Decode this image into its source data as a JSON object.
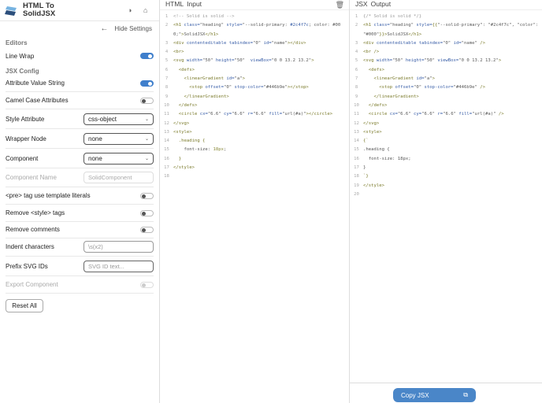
{
  "app": {
    "title_line1": "HTML To",
    "title_line2": "SolidJSX",
    "theme_icon": "contrast-icon",
    "github_icon": "github-icon",
    "accent": "#3f7fcc"
  },
  "settings": {
    "hide_label": "Hide Settings",
    "editors_heading": "Editors",
    "line_wrap": {
      "label": "Line Wrap",
      "on": true
    },
    "jsx_heading": "JSX Config",
    "attribute_value_string": {
      "label": "Attribute Value String",
      "on": true
    },
    "camel_case": {
      "label": "Camel Case Attributes",
      "on": false
    },
    "style_attribute": {
      "label": "Style Attribute",
      "value": "css-object"
    },
    "wrapper_node": {
      "label": "Wrapper Node",
      "value": "none"
    },
    "component": {
      "label": "Component",
      "value": "none"
    },
    "component_name": {
      "label": "Component Name",
      "placeholder": "SolidComponent"
    },
    "pre_tag": {
      "label": "<pre> tag use template literals",
      "on": false
    },
    "remove_style": {
      "label": "Remove <style> tags",
      "on": false
    },
    "remove_comments": {
      "label": "Remove comments",
      "on": false
    },
    "indent": {
      "label": "Indent characters",
      "placeholder": "\\s(x2)"
    },
    "prefix_svg": {
      "label": "Prefix SVG IDs",
      "placeholder": "SVG ID text..."
    },
    "export_component": {
      "label": "Export Component",
      "on": false
    },
    "reset_label": "Reset All"
  },
  "input": {
    "title_a": "HTML",
    "title_b": "Input",
    "lines": [
      [
        [
          "comment",
          "<!-- Solid is solid -->"
        ]
      ],
      [
        [
          "tag",
          "<h1 "
        ],
        [
          "attr",
          "class="
        ],
        [
          "str",
          "\"heading\" "
        ],
        [
          "attr",
          "style="
        ],
        [
          "str",
          "\"--solid-primary: "
        ],
        [
          "attr",
          "#2c4f7c"
        ],
        [
          "str",
          "; color: #000;\""
        ],
        [
          "tag",
          ">"
        ],
        [
          "plain",
          "SolidJSX"
        ],
        [
          "tag",
          "</h1>"
        ]
      ],
      [
        [
          "tag",
          "<div "
        ],
        [
          "attr",
          "contenteditable tabindex="
        ],
        [
          "str",
          "\"0\" "
        ],
        [
          "attr",
          "id="
        ],
        [
          "str",
          "\"name\""
        ],
        [
          "tag",
          "></div>"
        ]
      ],
      [
        [
          "tag",
          "<br>"
        ]
      ],
      [
        [
          "tag",
          "<svg "
        ],
        [
          "attr",
          "width="
        ],
        [
          "str",
          "\"50\" "
        ],
        [
          "attr",
          "height="
        ],
        [
          "str",
          "\"50\"  "
        ],
        [
          "attr",
          "viewBox="
        ],
        [
          "str",
          "\"0 0 13.2 13.2\""
        ],
        [
          "tag",
          ">"
        ]
      ],
      [
        [
          "tag",
          "  <defs>"
        ]
      ],
      [
        [
          "tag",
          "    <linearGradient "
        ],
        [
          "attr",
          "id="
        ],
        [
          "str",
          "\"a\""
        ],
        [
          "tag",
          ">"
        ]
      ],
      [
        [
          "tag",
          "      <stop "
        ],
        [
          "attr",
          "offset="
        ],
        [
          "str",
          "\"0\" "
        ],
        [
          "attr",
          "stop-color="
        ],
        [
          "str",
          "\"#446b9e\""
        ],
        [
          "tag",
          "></stop>"
        ]
      ],
      [
        [
          "tag",
          "    </linearGradient>"
        ]
      ],
      [
        [
          "tag",
          "  </defs>"
        ]
      ],
      [
        [
          "tag",
          "  <circle "
        ],
        [
          "attr",
          "cx="
        ],
        [
          "str",
          "\"6.6\" "
        ],
        [
          "attr",
          "cy="
        ],
        [
          "str",
          "\"6.6\" "
        ],
        [
          "attr",
          "r="
        ],
        [
          "str",
          "\"6.6\" "
        ],
        [
          "attr",
          "fill="
        ],
        [
          "str",
          "\"url(#a)\""
        ],
        [
          "tag",
          "></circle>"
        ]
      ],
      [
        [
          "tag",
          "</svg>"
        ]
      ],
      [
        [
          "tag",
          "<style>"
        ]
      ],
      [
        [
          "tag",
          "  .heading {"
        ]
      ],
      [
        [
          "plain",
          "    font-size: "
        ],
        [
          "num",
          "18px"
        ],
        [
          "plain",
          ";"
        ]
      ],
      [
        [
          "tag",
          "  }"
        ]
      ],
      [
        [
          "tag",
          "</style>"
        ]
      ],
      [
        [
          "plain",
          ""
        ]
      ]
    ]
  },
  "output": {
    "title_a": "JSX",
    "title_b": "Output",
    "copy_label": "Copy JSX",
    "lines": [
      [
        [
          "comment",
          "{/* Solid is solid */}"
        ]
      ],
      [
        [
          "tag",
          "<h1 "
        ],
        [
          "attr",
          "class="
        ],
        [
          "str",
          "\"heading\" "
        ],
        [
          "attr",
          "style="
        ],
        [
          "tag",
          "{{"
        ],
        [
          "str",
          "\"--solid-primary\": \"#2c4f7c\", \"color\": \"#000\""
        ],
        [
          "tag",
          "}}>"
        ],
        [
          "plain",
          "SolidJSX"
        ],
        [
          "tag",
          "</h1>"
        ]
      ],
      [
        [
          "tag",
          "<div "
        ],
        [
          "attr",
          "contenteditable tabindex="
        ],
        [
          "str",
          "\"0\" "
        ],
        [
          "attr",
          "id="
        ],
        [
          "str",
          "\"name\" "
        ],
        [
          "tag",
          "/>"
        ]
      ],
      [
        [
          "tag",
          "<br />"
        ]
      ],
      [
        [
          "tag",
          "<svg "
        ],
        [
          "attr",
          "width="
        ],
        [
          "str",
          "\"50\" "
        ],
        [
          "attr",
          "height="
        ],
        [
          "str",
          "\"50\" "
        ],
        [
          "attr",
          "viewBox="
        ],
        [
          "str",
          "\"0 0 13.2 13.2\""
        ],
        [
          "tag",
          ">"
        ]
      ],
      [
        [
          "tag",
          "  <defs>"
        ]
      ],
      [
        [
          "tag",
          "    <linearGradient "
        ],
        [
          "attr",
          "id="
        ],
        [
          "str",
          "\"a\""
        ],
        [
          "tag",
          ">"
        ]
      ],
      [
        [
          "tag",
          "      <stop "
        ],
        [
          "attr",
          "offset="
        ],
        [
          "str",
          "\"0\" "
        ],
        [
          "attr",
          "stop-color="
        ],
        [
          "str",
          "\"#446b9e\" "
        ],
        [
          "tag",
          "/>"
        ]
      ],
      [
        [
          "tag",
          "    </linearGradient>"
        ]
      ],
      [
        [
          "tag",
          "  </defs>"
        ]
      ],
      [
        [
          "tag",
          "  <circle "
        ],
        [
          "attr",
          "cx="
        ],
        [
          "str",
          "\"6.6\" "
        ],
        [
          "attr",
          "cy="
        ],
        [
          "str",
          "\"6.6\" "
        ],
        [
          "attr",
          "r="
        ],
        [
          "str",
          "\"6.6\" "
        ],
        [
          "attr",
          "fill="
        ],
        [
          "str",
          "\"url(#a)\" "
        ],
        [
          "tag",
          "/>"
        ]
      ],
      [
        [
          "tag",
          "</svg>"
        ]
      ],
      [
        [
          "tag",
          "<style>"
        ]
      ],
      [
        [
          "tag",
          "{`"
        ]
      ],
      [
        [
          "plain",
          ".heading {"
        ]
      ],
      [
        [
          "plain",
          "  font-size: 18px;"
        ]
      ],
      [
        [
          "plain",
          "}"
        ]
      ],
      [
        [
          "tag",
          "`}"
        ]
      ],
      [
        [
          "tag",
          "</style>"
        ]
      ],
      [
        [
          "plain",
          ""
        ]
      ]
    ]
  }
}
